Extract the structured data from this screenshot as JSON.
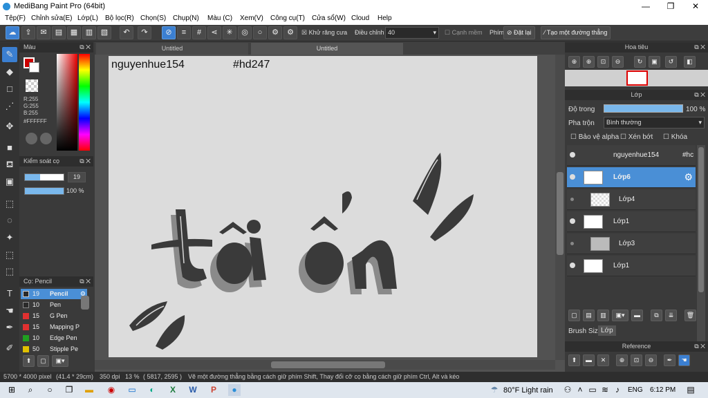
{
  "window": {
    "title": "MediBang Paint Pro (64bit)",
    "minimize": "—",
    "maximize": "❐",
    "close": "✕"
  },
  "menu": [
    "Tệp(F)",
    "Chỉnh sửa(E)",
    "Lớp(L)",
    "Bộ lọc(R)",
    "Chọn(S)",
    "Chụp(N)",
    "Màu (C)",
    "Xem(V)",
    "Công cụ(T)",
    "Cửa sổ(W)",
    "Cloud",
    "Help"
  ],
  "toolbar": {
    "antialias_label": "Khử răng cưa",
    "adjust_label": "Điều chỉnh",
    "adjust_value": "40",
    "edge_label": "Cạnh mềm",
    "key_label": "Phím",
    "reset_label": "Đặt lại",
    "straight_line_label": "Tạo một đường thẳng"
  },
  "color_panel": {
    "title": "Màu",
    "r": "R:255",
    "g": "G:255",
    "b": "B:255",
    "hex": "#FFFFFF"
  },
  "brush_control": {
    "title": "Kiểm soát cọ",
    "size": "19",
    "opacity": "100 %"
  },
  "brush_panel": {
    "title": "Cọ: Pencil",
    "items": [
      {
        "size": "19",
        "name": "Pencil",
        "color": "#2a2a2a",
        "selected": true
      },
      {
        "size": "10",
        "name": "Pen",
        "color": "#2a2a2a",
        "selected": false
      },
      {
        "size": "15",
        "name": "G Pen",
        "color": "#e03030",
        "selected": false
      },
      {
        "size": "15",
        "name": "Mapping P",
        "color": "#e03030",
        "selected": false
      },
      {
        "size": "10",
        "name": "Edge Pen",
        "color": "#20a020",
        "selected": false
      },
      {
        "size": "50",
        "name": "Stipple Pe",
        "color": "#e0c000",
        "selected": false
      }
    ]
  },
  "tabs": [
    "Untitled",
    "Untitled"
  ],
  "canvas": {
    "text_left": "nguyenhue154",
    "text_right": "#hd247"
  },
  "navigator": {
    "title": "Hoa tiêu"
  },
  "layer_panel": {
    "title": "Lớp",
    "opacity_label": "Độ trong",
    "opacity_value": "100 %",
    "blend_label": "Pha trộn",
    "blend_value": "Bình thường",
    "protect_alpha": "Bảo vệ alpha",
    "clipping": "Xén bớt",
    "lock": "Khóa",
    "layers": [
      {
        "name": "nguyenhue154",
        "extra": "#hc",
        "selected": false
      },
      {
        "name": "Lớp6",
        "extra": "",
        "selected": true
      },
      {
        "name": "Lớp4",
        "extra": "",
        "selected": false
      },
      {
        "name": "Lớp1",
        "extra": "",
        "selected": false
      },
      {
        "name": "Lớp3",
        "extra": "",
        "selected": false
      },
      {
        "name": "Lớp1",
        "extra": "",
        "selected": false
      }
    ],
    "tab_brush_size": "Brush Size",
    "tab_layer": "Lớp"
  },
  "reference": {
    "title": "Reference"
  },
  "status": {
    "size": "5700 * 4000 pixel",
    "cm": "(41.4 * 29cm)",
    "dpi": "350 dpi",
    "zoom": "13 %",
    "coords": "( 5817, 2595 )",
    "hint": "Vẽ một đường thẳng bằng cách giữ phím Shift, Thay đổi cỡ cọ bằng cách giữ phím Ctrl, Alt và kéo"
  },
  "taskbar": {
    "weather": "80°F  Light rain",
    "lang": "ENG",
    "time": "6:12 PM"
  }
}
